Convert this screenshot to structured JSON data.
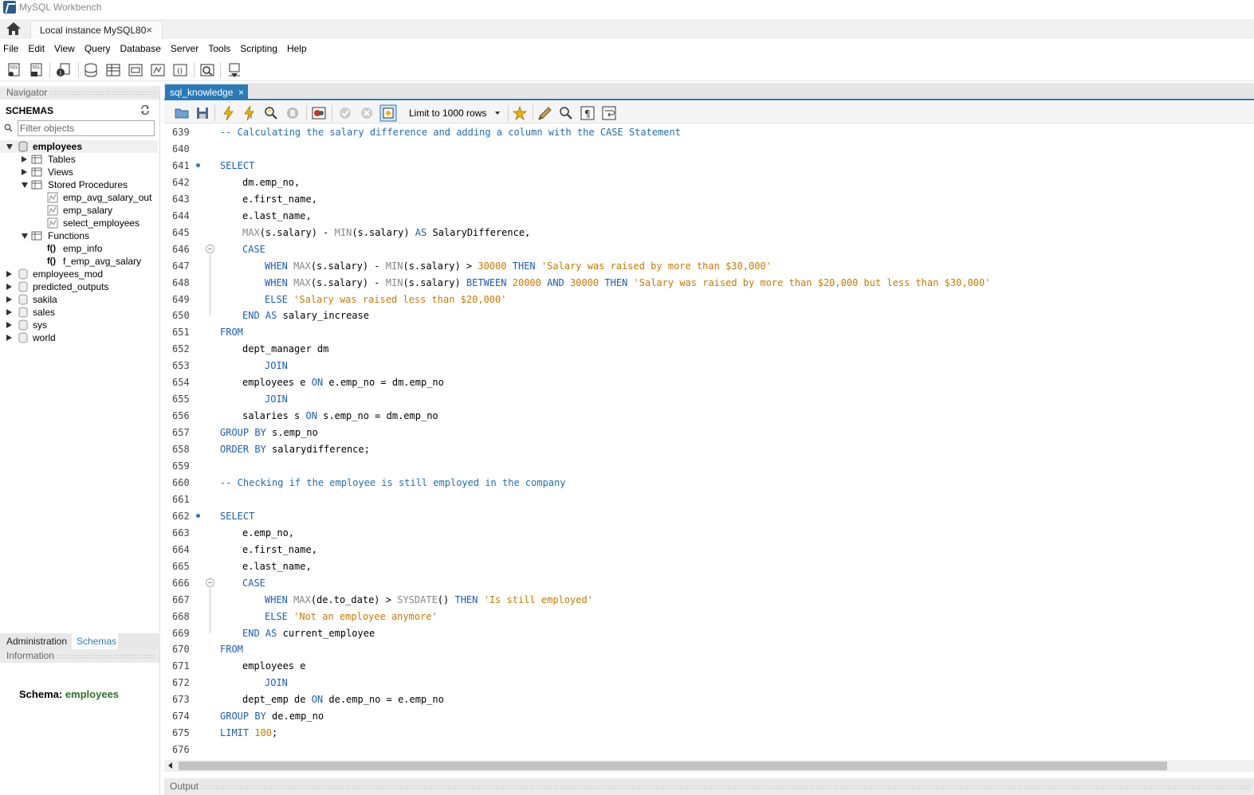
{
  "window": {
    "title": "MySQL Workbench"
  },
  "connection_tab": {
    "label": "Local instance MySQL80",
    "close": "×"
  },
  "menu": [
    "File",
    "Edit",
    "View",
    "Query",
    "Database",
    "Server",
    "Tools",
    "Scripting",
    "Help"
  ],
  "navigator": {
    "header": "Navigator",
    "schemas_label": "SCHEMAS",
    "filter_placeholder": "Filter objects",
    "tree": {
      "employees": "employees",
      "tables": "Tables",
      "views": "Views",
      "stored_procedures": "Stored Procedures",
      "procedures": [
        "emp_avg_salary_out",
        "emp_salary",
        "select_employees"
      ],
      "functions": "Functions",
      "function_items": [
        "emp_info",
        "f_emp_avg_salary"
      ],
      "fn_prefix": "f()",
      "other_schemas": [
        "employees_mod",
        "predicted_outputs",
        "sakila",
        "sales",
        "sys",
        "world"
      ]
    }
  },
  "bottom_tabs": {
    "administration": "Administration",
    "schemas": "Schemas"
  },
  "information": {
    "header": "Information",
    "schema_label": "Schema:",
    "schema_value": "employees"
  },
  "editor": {
    "tab_label": "sql_knowledge",
    "tab_close": "×",
    "limit_rows": "Limit to 1000 rows"
  },
  "code_lines": [
    {
      "n": "639"
    },
    {
      "n": "640"
    },
    {
      "n": "641"
    },
    {
      "n": "642"
    },
    {
      "n": "643"
    },
    {
      "n": "644"
    },
    {
      "n": "645"
    },
    {
      "n": "646"
    },
    {
      "n": "647"
    },
    {
      "n": "648"
    },
    {
      "n": "649"
    },
    {
      "n": "650"
    },
    {
      "n": "651"
    },
    {
      "n": "652"
    },
    {
      "n": "653"
    },
    {
      "n": "654"
    },
    {
      "n": "655"
    },
    {
      "n": "656"
    },
    {
      "n": "657"
    },
    {
      "n": "658"
    },
    {
      "n": "659"
    },
    {
      "n": "660"
    },
    {
      "n": "661"
    },
    {
      "n": "662"
    },
    {
      "n": "663"
    },
    {
      "n": "664"
    },
    {
      "n": "665"
    },
    {
      "n": "666"
    },
    {
      "n": "667"
    },
    {
      "n": "668"
    },
    {
      "n": "669"
    },
    {
      "n": "670"
    },
    {
      "n": "671"
    },
    {
      "n": "672"
    },
    {
      "n": "673"
    },
    {
      "n": "674"
    },
    {
      "n": "675"
    },
    {
      "n": "676"
    }
  ],
  "code": {
    "c639": "-- Calculating the salary difference and adding a column with the CASE Statement",
    "select": "SELECT",
    "dm_emp_no": "dm.emp_no,",
    "e_first_name": "e.first_name,",
    "e_last_name": "e.last_name,",
    "max": "MAX",
    "min": "MIN",
    "s_salary": "(s.salary)",
    "minus": " - ",
    "as_salarydiff": " SalaryDifference,",
    "as": "AS",
    "case": "CASE",
    "when": "WHEN",
    "then": "THEN",
    "gt": " > ",
    "between": "BETWEEN",
    "and": "AND",
    "else": "ELSE",
    "end": "END",
    "n30000": "30000",
    "n20000": "20000",
    "s647": "'Salary was raised by more than $30,000'",
    "s648": "'Salary was raised by more than $20,000 but less than $30,000'",
    "s649": "'Salary was raised less than $20,000'",
    "salary_increase": " salary_increase",
    "from": "FROM",
    "dept_manager": "dept_manager dm",
    "join": "JOIN",
    "employees_e": "employees e ",
    "on": "ON",
    "on_e_dm": " e.emp_no = dm.emp_no",
    "salaries_s": "salaries s ",
    "on_s_dm": " s.emp_no = dm.emp_no",
    "group_by": "GROUP BY",
    "s_emp_no": " s.emp_no",
    "order_by": "ORDER BY",
    "salarydiff_semi": " salarydifference;",
    "c660": "-- Checking if the employee is still employed in the company",
    "e_emp_no": "e.emp_no,",
    "de_to_date": "(de.to_date)",
    "sysdate": "SYSDATE",
    "paren": "()",
    "s667": "'Is still employed'",
    "s668": "'Not an employee anymore'",
    "current_employee": " current_employee",
    "employees_e2": "employees e",
    "dept_emp_de": "dept_emp de ",
    "on_de_e": " de.emp_no = e.emp_no",
    "de_emp_no": " de.emp_no",
    "limit": "LIMIT",
    "n100": "100",
    "semi": ";"
  },
  "output": {
    "header": "Output"
  },
  "colors": {
    "accent": "#2a7ab8",
    "keyword": "#1a5fb4",
    "string": "#c87a00",
    "function": "#888888"
  }
}
